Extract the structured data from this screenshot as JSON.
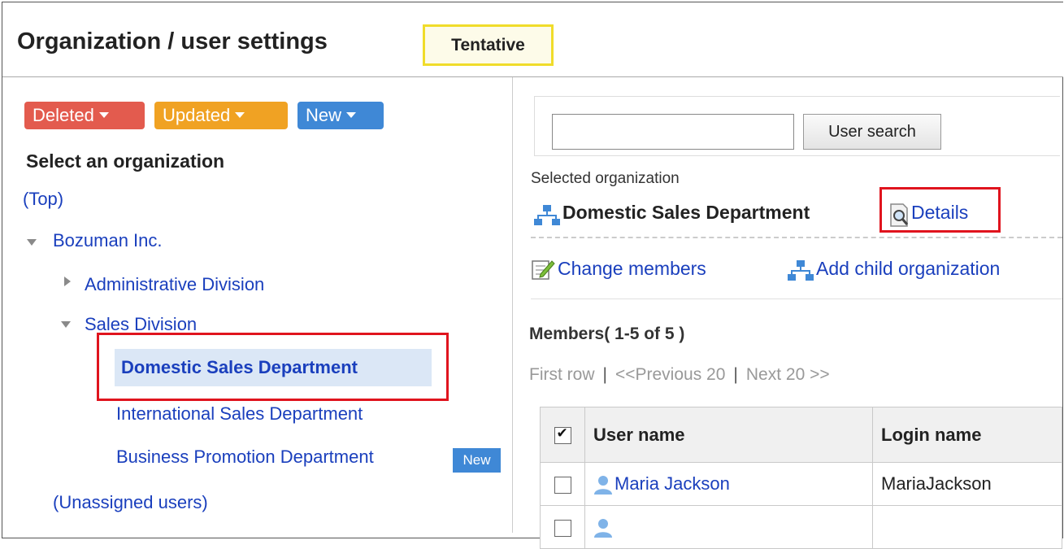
{
  "header": {
    "title": "Organization / user settings",
    "badge": "Tentative"
  },
  "filters": {
    "deleted": "Deleted",
    "updated": "Updated",
    "new": "New",
    "colors": {
      "deleted": "#e35b4e",
      "updated": "#f0a223",
      "new": "#3f88d6"
    }
  },
  "tree": {
    "heading": "Select an organization",
    "top": "(Top)",
    "root": "Bozuman Inc.",
    "administrative": "Administrative Division",
    "sales": "Sales Division",
    "domestic": "Domestic Sales Department",
    "international": "International Sales Department",
    "business": "Business Promotion Department",
    "new_badge": "New",
    "unassigned": "(Unassigned users)"
  },
  "search": {
    "value": "",
    "button": "User search"
  },
  "selected": {
    "label": "Selected organization",
    "name": "Domestic Sales Department",
    "details": "Details"
  },
  "actions": {
    "change_members": "Change members",
    "add_child": "Add child organization"
  },
  "members": {
    "title": "Members( 1-5 of 5 )",
    "pager": {
      "first": "First row",
      "prev": "<<Previous 20",
      "next": "Next 20 >>"
    },
    "columns": {
      "user_name": "User name",
      "login_name": "Login name"
    },
    "rows": [
      {
        "user_name": "Maria Jackson",
        "login_name": "MariaJackson"
      }
    ]
  }
}
